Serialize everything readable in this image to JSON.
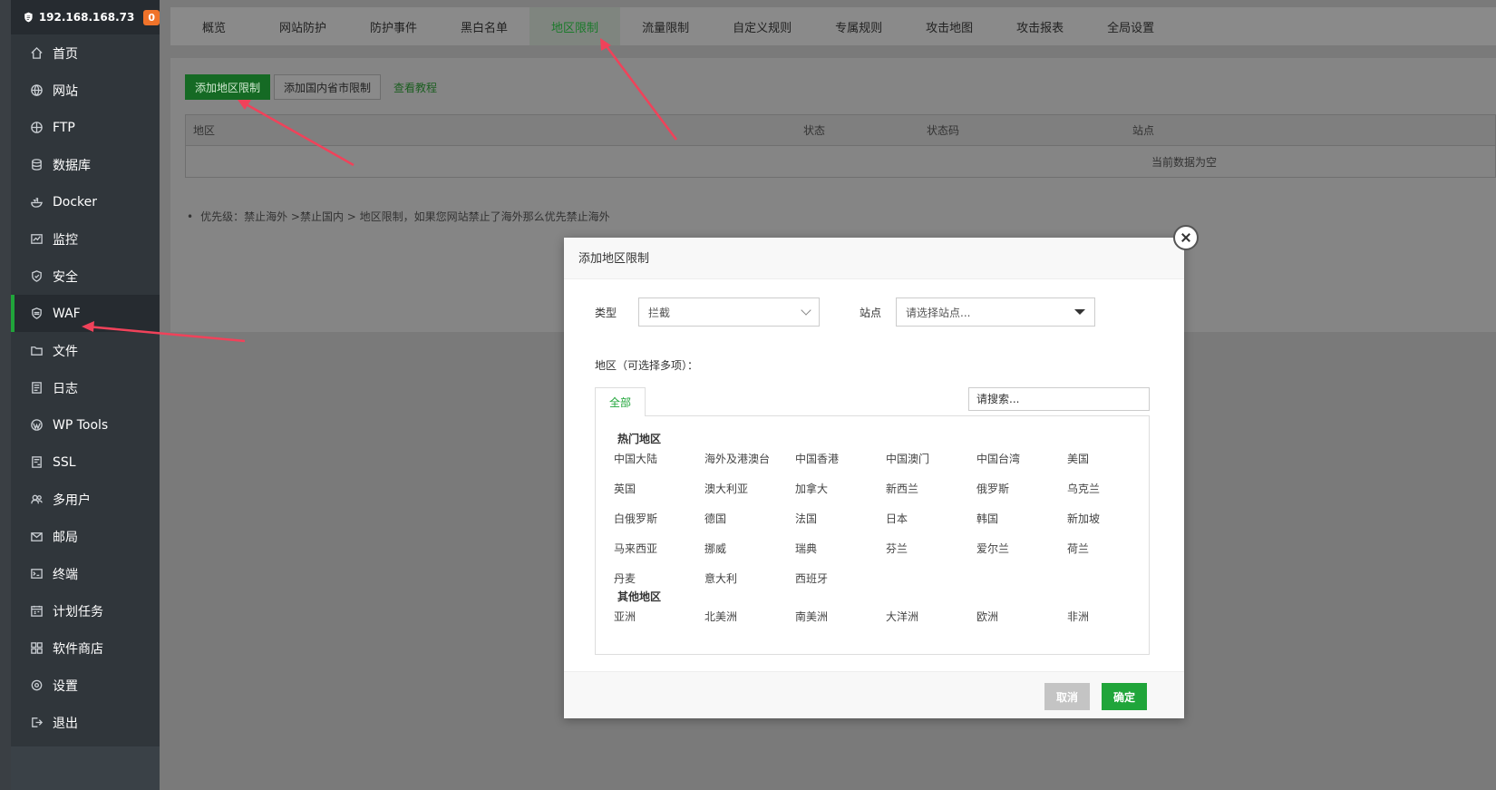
{
  "sidebar": {
    "host": "192.168.168.73",
    "badge": "0",
    "items": [
      {
        "label": "首页",
        "icon": "home-icon"
      },
      {
        "label": "网站",
        "icon": "globe-icon"
      },
      {
        "label": "FTP",
        "icon": "ftp-icon"
      },
      {
        "label": "数据库",
        "icon": "database-icon"
      },
      {
        "label": "Docker",
        "icon": "docker-icon"
      },
      {
        "label": "监控",
        "icon": "monitor-icon"
      },
      {
        "label": "安全",
        "icon": "shield-icon"
      },
      {
        "label": "WAF",
        "icon": "waf-icon",
        "active": true
      },
      {
        "label": "文件",
        "icon": "folder-icon"
      },
      {
        "label": "日志",
        "icon": "log-icon"
      },
      {
        "label": "WP Tools",
        "icon": "wordpress-icon"
      },
      {
        "label": "SSL",
        "icon": "ssl-icon"
      },
      {
        "label": "多用户",
        "icon": "users-icon"
      },
      {
        "label": "邮局",
        "icon": "mail-icon"
      },
      {
        "label": "终端",
        "icon": "terminal-icon"
      },
      {
        "label": "计划任务",
        "icon": "calendar-icon"
      },
      {
        "label": "软件商店",
        "icon": "apps-icon"
      },
      {
        "label": "设置",
        "icon": "gear-icon"
      },
      {
        "label": "退出",
        "icon": "logout-icon"
      }
    ]
  },
  "tabs": [
    "概览",
    "网站防护",
    "防护事件",
    "黑白名单",
    "地区限制",
    "流量限制",
    "自定义规则",
    "专属规则",
    "攻击地图",
    "攻击报表",
    "全局设置"
  ],
  "active_tab": "地区限制",
  "toolbar": {
    "add_region": "添加地区限制",
    "add_province": "添加国内省市限制",
    "tutorial": "查看教程"
  },
  "table": {
    "headers": [
      "地区",
      "状态",
      "状态码",
      "站点"
    ],
    "empty": "当前数据为空"
  },
  "tip": "优先级：禁止海外 >禁止国内 > 地区限制，如果您网站禁止了海外那么优先禁止海外",
  "modal": {
    "title": "添加地区限制",
    "type_label": "类型",
    "type_value": "拦截",
    "site_label": "站点",
    "site_value": "请选择站点...",
    "region_label": "地区（可选择多项）：",
    "tab_all": "全部",
    "search_placeholder": "请搜索...",
    "hot_title": "热门地区",
    "hot": [
      "中国大陆",
      "海外及港澳台",
      "中国香港",
      "中国澳门",
      "中国台湾",
      "美国",
      "英国",
      "澳大利亚",
      "加拿大",
      "新西兰",
      "俄罗斯",
      "乌克兰",
      "白俄罗斯",
      "德国",
      "法国",
      "日本",
      "韩国",
      "新加坡",
      "马来西亚",
      "挪威",
      "瑞典",
      "芬兰",
      "爱尔兰",
      "荷兰",
      "丹麦",
      "意大利",
      "西班牙"
    ],
    "other_title": "其他地区",
    "other": [
      "亚洲",
      "北美洲",
      "南美洲",
      "大洋洲",
      "欧洲",
      "非洲"
    ],
    "cancel": "取消",
    "ok": "确定"
  },
  "colors": {
    "accent": "#20a53a",
    "sidebar": "#30363b",
    "arrow": "#f0425a"
  }
}
